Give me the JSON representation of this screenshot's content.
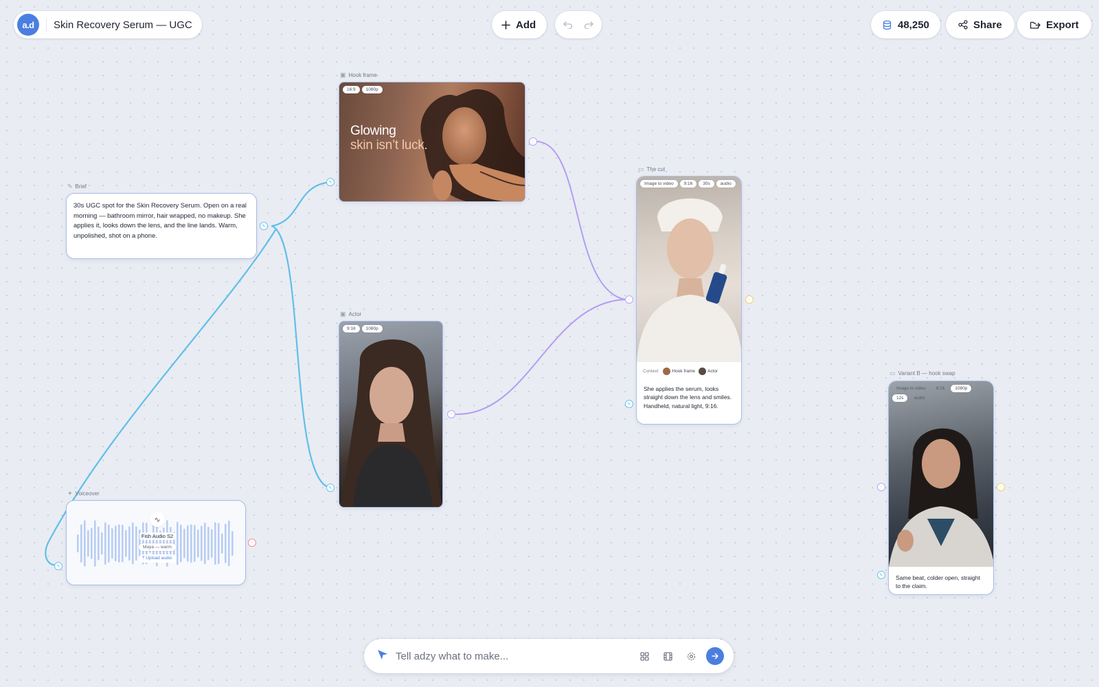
{
  "app": {
    "logo_text": "a.d",
    "project_title": "Skin Recovery Serum — UGC"
  },
  "toolbar": {
    "add_label": "Add",
    "credits": "48,250",
    "share_label": "Share",
    "export_label": "Export"
  },
  "nodes": {
    "brief": {
      "label": "Brief",
      "text": "30s UGC spot for the Skin Recovery Serum. Open on a real morning — bathroom mirror, hair wrapped, no makeup. She applies it, looks down the lens, and the line lands. Warm, unpolished, shot on a phone."
    },
    "hook": {
      "label": "Hook frame",
      "tags": [
        "16:9",
        "1080p"
      ],
      "headline_line1": "Glowing",
      "headline_line2": "skin isn’t luck."
    },
    "actor": {
      "label": "Actor",
      "tags": [
        "9:16",
        "1080p"
      ]
    },
    "cut": {
      "label": "The cut",
      "tags": [
        "Image to video",
        "9:16",
        "30s",
        "audio"
      ],
      "context_label": "Context",
      "context_refs": [
        "Hook frame",
        "Actor"
      ],
      "description": "She applies the serum, looks straight down the lens and smiles. Handheld, natural light, 9:16."
    },
    "variant": {
      "label": "Variant B — hook swap",
      "tags": [
        "Image to video",
        "9:16",
        "1080p",
        "12s",
        "audio"
      ],
      "description": "Same beat, colder open, straight to the claim."
    },
    "voice": {
      "label": "Voiceover",
      "model": "Fish Audio S2",
      "voice_name": "Maya — warm",
      "upload_label": "Upload audio"
    }
  },
  "prompt": {
    "placeholder": "Tell adzy what to make..."
  },
  "colors": {
    "accent": "#4a7fe0",
    "edge_blue": "#5fbfea",
    "edge_purple": "#b49cf2",
    "node_border": "#a8bde8",
    "port_yellow": "#f3cf5f",
    "port_red": "#f28b9c"
  }
}
